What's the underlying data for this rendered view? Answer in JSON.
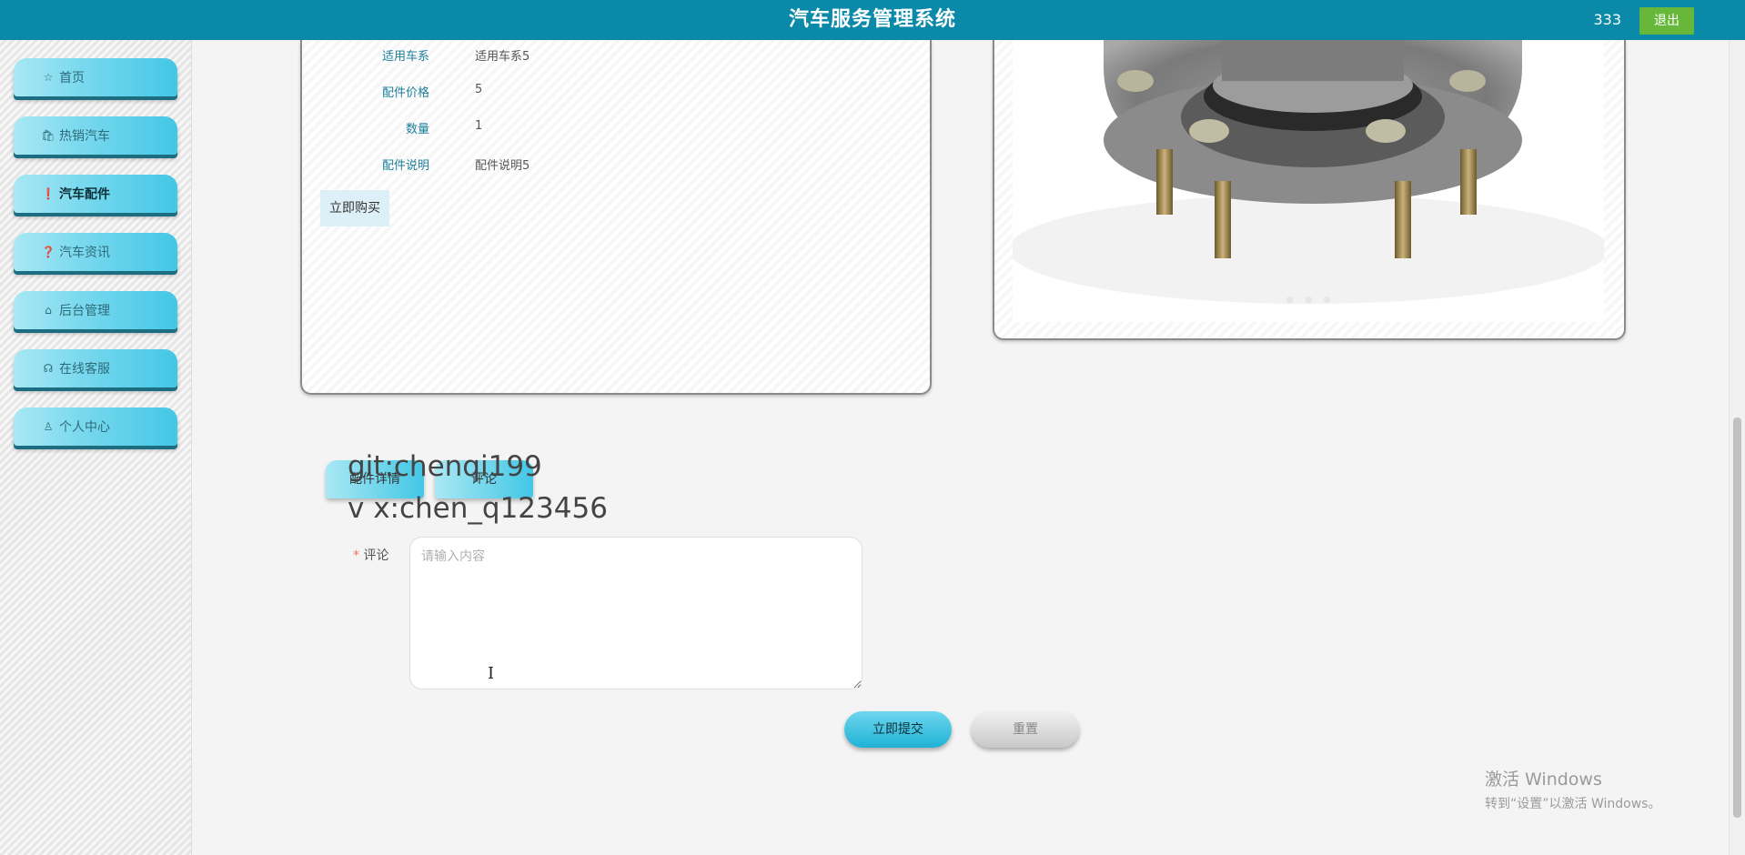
{
  "header": {
    "title": "汽车服务管理系统",
    "username": "333",
    "logout_label": "退出"
  },
  "sidebar": {
    "items": [
      {
        "label": "首页",
        "icon": "star-icon"
      },
      {
        "label": "热销汽车",
        "icon": "bag-icon"
      },
      {
        "label": "汽车配件",
        "icon": "info-icon",
        "active": true
      },
      {
        "label": "汽车资讯",
        "icon": "question-icon"
      },
      {
        "label": "后台管理",
        "icon": "shop-icon"
      },
      {
        "label": "在线客服",
        "icon": "headset-icon"
      },
      {
        "label": "个人中心",
        "icon": "user-icon"
      }
    ]
  },
  "detail": {
    "fields": [
      {
        "label": "适用车系",
        "value": "适用车系5"
      },
      {
        "label": "配件价格",
        "value": "5"
      },
      {
        "label": "数量",
        "value": "1"
      },
      {
        "label": "配件说明",
        "value": "配件说明5"
      }
    ],
    "buy_label": "立即购买"
  },
  "tabs": [
    {
      "label": "配件详情"
    },
    {
      "label": "评论"
    }
  ],
  "overlay_text": {
    "line1": "git:chenqi199",
    "line2": "v x:chen_q123456"
  },
  "comment_form": {
    "label": "评论",
    "required_mark": "* ",
    "placeholder": "请输入内容",
    "submit_label": "立即提交",
    "reset_label": "重置"
  },
  "system_notice": {
    "line1": "激活 Windows",
    "line2": "转到“设置”以激活 Windows。"
  },
  "colors": {
    "header": "#0a8aa8",
    "nav_accent": "#42c7e6",
    "logout": "#67b83a"
  }
}
